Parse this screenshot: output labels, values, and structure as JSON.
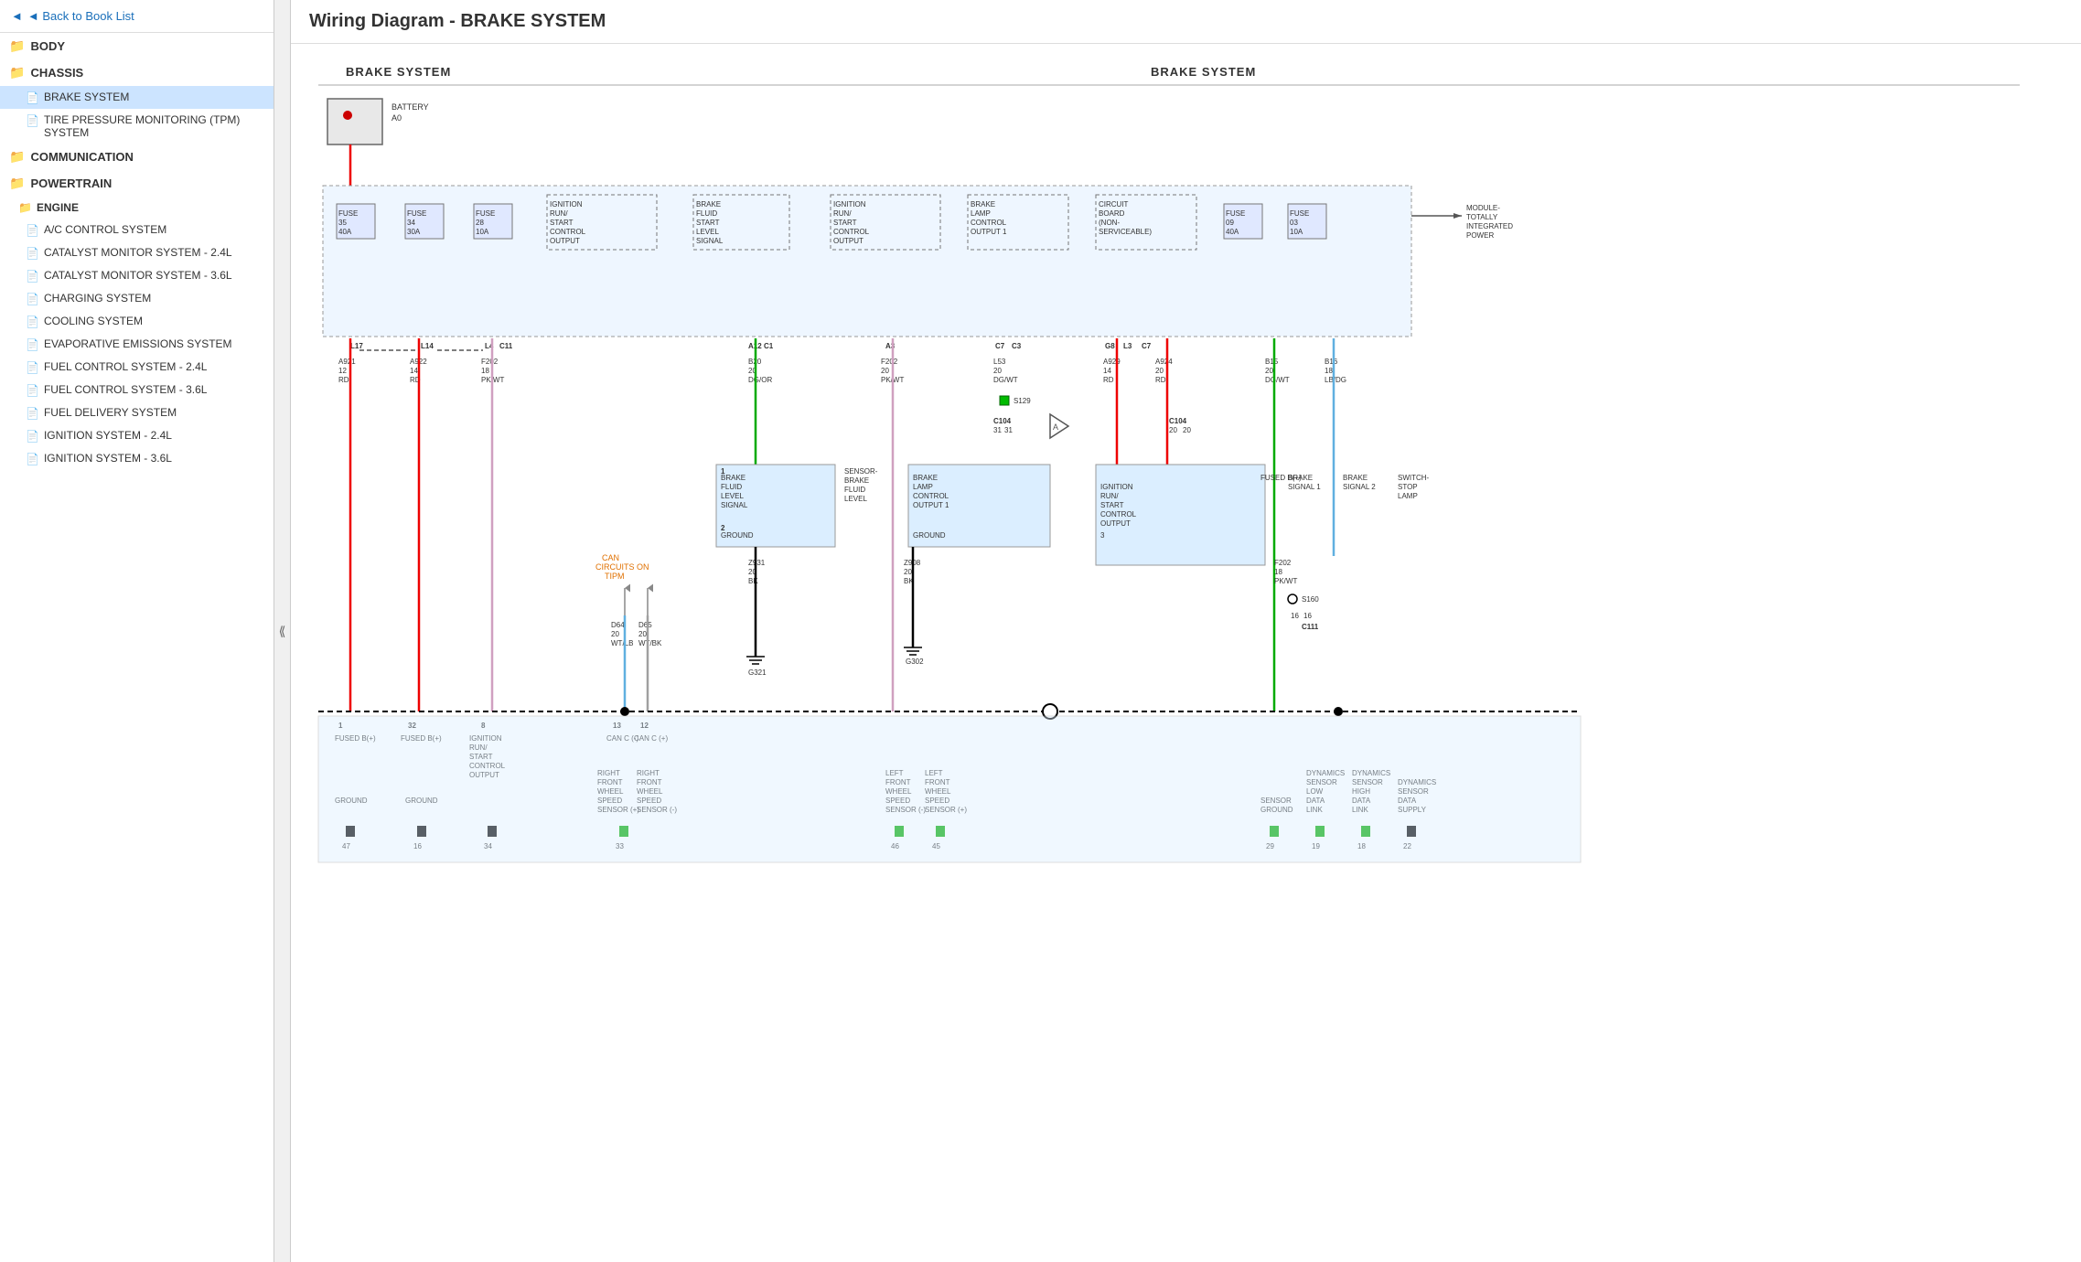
{
  "sidebar": {
    "back_label": "◄ Back to Book List",
    "sections": [
      {
        "type": "section",
        "label": "BODY",
        "icon": "folder",
        "items": []
      },
      {
        "type": "section",
        "label": "CHASSIS",
        "icon": "folder",
        "items": [
          {
            "label": "BRAKE SYSTEM",
            "active": true
          },
          {
            "label": "TIRE PRESSURE MONITORING (TPM) SYSTEM",
            "active": false
          }
        ]
      },
      {
        "type": "section",
        "label": "COMMUNICATION",
        "icon": "folder",
        "items": []
      },
      {
        "type": "section",
        "label": "POWERTRAIN",
        "icon": "folder",
        "items": []
      },
      {
        "type": "subsection",
        "label": "ENGINE",
        "icon": "folder",
        "items": [
          {
            "label": "A/C CONTROL SYSTEM"
          },
          {
            "label": "CATALYST MONITOR SYSTEM - 2.4L"
          },
          {
            "label": "CATALYST MONITOR SYSTEM - 3.6L"
          },
          {
            "label": "CHARGING SYSTEM"
          },
          {
            "label": "COOLING SYSTEM"
          },
          {
            "label": "EVAPORATIVE EMISSIONS SYSTEM"
          },
          {
            "label": "FUEL CONTROL SYSTEM - 2.4L"
          },
          {
            "label": "FUEL CONTROL SYSTEM - 3.6L"
          },
          {
            "label": "FUEL DELIVERY SYSTEM"
          },
          {
            "label": "IGNITION SYSTEM - 2.4L"
          },
          {
            "label": "IGNITION SYSTEM - 3.6L"
          }
        ]
      }
    ]
  },
  "main": {
    "title": "Wiring Diagram - BRAKE SYSTEM"
  },
  "diagram": {
    "section_label_left": "BRAKE SYSTEM",
    "section_label_right": "BRAKE SYSTEM",
    "module_label": "MODULE-\nTOTALLY\nINTEGRATED\nPOWER"
  }
}
